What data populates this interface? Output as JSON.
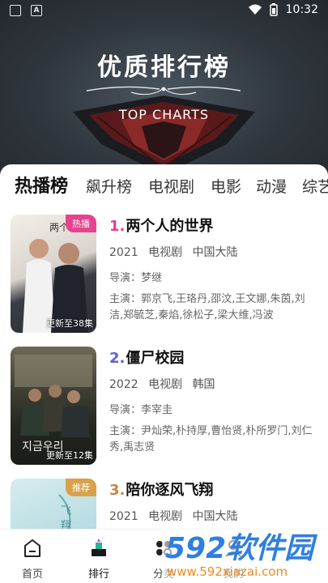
{
  "status_bar": {
    "time": "10:32"
  },
  "banner": {
    "title": "优质排行榜",
    "subtitle": "TOP CHARTS"
  },
  "tabs": [
    "热播榜",
    "飙升榜",
    "电视剧",
    "电影",
    "动漫",
    "综艺"
  ],
  "items": [
    {
      "rank": "1.",
      "rank_color": "#e83f8f",
      "title": "两个人的世界",
      "year": "2021",
      "type": "电视剧",
      "region": "中国大陆",
      "director": "导演：梦继",
      "cast": "主演：郭京飞,王珞丹,邵汶,王文娜,朱茵,刘洁,郑毓芝,秦焰,徐松子,梁大维,冯波",
      "badge": "热播",
      "badge_color": "#e8418f",
      "update": "更新至38集"
    },
    {
      "rank": "2.",
      "rank_color": "#5a63d8",
      "title": "僵尸校园",
      "year": "2022",
      "type": "电视剧",
      "region": "韩国",
      "director": "导演：李宰圭",
      "cast": "主演：尹灿荣,朴持厚,曹怡贤,朴所罗门,刘仁秀,禹志贤",
      "badge": "",
      "badge_color": "#5a63d8",
      "update": "更新至12集"
    },
    {
      "rank": "3.",
      "rank_color": "#c0884a",
      "title": "陪你逐风飞翔",
      "year": "2021",
      "type": "电视剧",
      "region": "中国大陆",
      "director": "",
      "cast": "",
      "badge": "推荐",
      "badge_color": "#d9a24a",
      "update": ""
    }
  ],
  "bottom_nav": [
    {
      "label": "首页",
      "icon": "home-icon"
    },
    {
      "label": "排行",
      "icon": "trophy-icon"
    },
    {
      "label": "分类",
      "icon": "category-icon"
    },
    {
      "label": "我的",
      "icon": "user-icon"
    }
  ],
  "watermark": {
    "brand": "592软件园",
    "url": "www.592xiazai.com"
  }
}
